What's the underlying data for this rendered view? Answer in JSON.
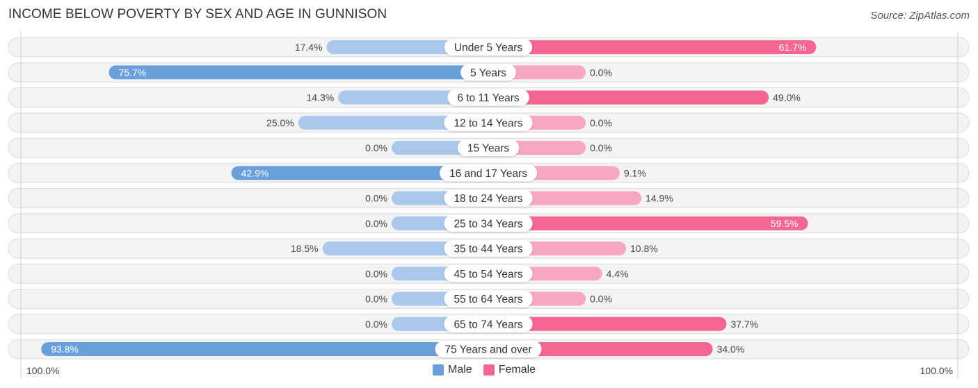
{
  "header": {
    "title": "INCOME BELOW POVERTY BY SEX AND AGE IN GUNNISON",
    "source": "Source: ZipAtlas.com"
  },
  "legend": {
    "male_label": "Male",
    "female_label": "Female"
  },
  "axis": {
    "left_label": "100.0%",
    "right_label": "100.0%"
  },
  "colors": {
    "male_strong": "#6a9fdb",
    "male_light": "#a9c8ec",
    "female_strong": "#f2668f",
    "female_light": "#f7a7bf",
    "track": "#f3f3f3",
    "track_border": "#dcdcdc"
  },
  "chart_data": {
    "type": "bar",
    "orientation": "horizontal-diverging",
    "title": "INCOME BELOW POVERTY BY SEX AND AGE IN GUNNISON",
    "xlabel": "",
    "ylabel": "",
    "xlim": [
      -100,
      100
    ],
    "legend_position": "bottom-center",
    "categories": [
      "Under 5 Years",
      "5 Years",
      "6 to 11 Years",
      "12 to 14 Years",
      "15 Years",
      "16 and 17 Years",
      "18 to 24 Years",
      "25 to 34 Years",
      "35 to 44 Years",
      "45 to 54 Years",
      "55 to 64 Years",
      "65 to 74 Years",
      "75 Years and over"
    ],
    "series": [
      {
        "name": "Male",
        "values": [
          17.4,
          75.7,
          14.3,
          25.0,
          0.0,
          42.9,
          0.0,
          0.0,
          18.5,
          0.0,
          0.0,
          0.0,
          93.8
        ],
        "labels": [
          "17.4%",
          "75.7%",
          "14.3%",
          "25.0%",
          "0.0%",
          "42.9%",
          "0.0%",
          "0.0%",
          "18.5%",
          "0.0%",
          "0.0%",
          "0.0%",
          "93.8%"
        ]
      },
      {
        "name": "Female",
        "values": [
          61.7,
          0.0,
          49.0,
          0.0,
          0.0,
          9.1,
          14.9,
          59.5,
          10.8,
          4.4,
          0.0,
          37.7,
          34.0
        ],
        "labels": [
          "61.7%",
          "0.0%",
          "49.0%",
          "0.0%",
          "0.0%",
          "9.1%",
          "14.9%",
          "59.5%",
          "10.8%",
          "4.4%",
          "0.0%",
          "37.7%",
          "34.0%"
        ]
      }
    ]
  }
}
